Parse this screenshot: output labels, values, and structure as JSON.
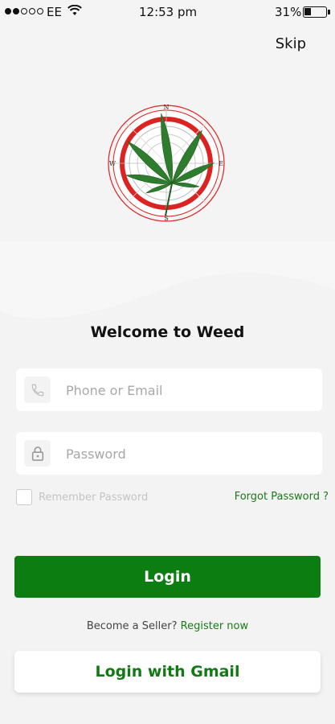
{
  "status_bar": {
    "carrier": "EE",
    "time": "12:53 pm",
    "battery": "31%",
    "battery_level": 0.31,
    "signal_bars_filled": 2,
    "signal_bars_total": 5
  },
  "header": {
    "skip_label": "Skip"
  },
  "logo": {
    "compass_letters": [
      "N",
      "E",
      "S",
      "W"
    ]
  },
  "welcome_title": "Welcome to Weed",
  "phone_field": {
    "placeholder": "Phone or Email",
    "value": "",
    "icon": "phone-icon"
  },
  "password_field": {
    "placeholder": "Password",
    "value": "",
    "icon": "lock-icon"
  },
  "remember": {
    "label": "Remember Password",
    "checked": false
  },
  "forgot_label": "Forgot Password ?",
  "login_label": "Login",
  "seller": {
    "question": "Become a Seller?",
    "link": "Register now"
  },
  "gmail_label": "Login with Gmail",
  "colors": {
    "primary_green": "#0c7d10",
    "link_green": "#1a7a1a",
    "background": "#f3f3f3"
  }
}
